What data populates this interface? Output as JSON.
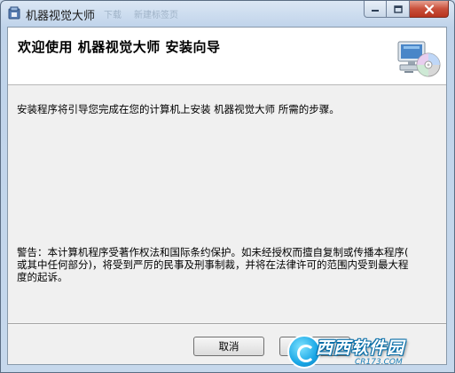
{
  "window": {
    "title": "机器视觉大师",
    "ghost_tabs": [
      "新建标签页",
      "下载",
      "机器视觉大师"
    ],
    "caption_buttons": {
      "minimize_icon": "minimize-icon",
      "maximize_icon": "maximize-icon",
      "close_icon": "close-icon"
    }
  },
  "header": {
    "title": "欢迎使用 机器视觉大师 安装向导",
    "art_icon": "computer-cd-icon"
  },
  "body": {
    "intro": "安装程序将引导您完成在您的计算机上安装 机器视觉大师 所需的步骤。",
    "warning_lines": [
      "警告：本计算机程序受著作权法和国际条约保护。如未经授权而擅自复制或传播本程序(",
      "或其中任何部分)，将受到严厉的民事及刑事制裁，并将在法律许可的范围内受到最大程",
      "度的起诉。"
    ]
  },
  "footer": {
    "cancel_label": "取消",
    "next_label": "下一步"
  },
  "watermark": {
    "name": "西西软件园",
    "url": "CR173.COM"
  },
  "colors": {
    "frame": "#c6d8ec",
    "client_bg": "#f0f0f0",
    "header_bg": "#ffffff",
    "close_button": "#c94f3a",
    "watermark_blue": "#1aa7e6"
  }
}
